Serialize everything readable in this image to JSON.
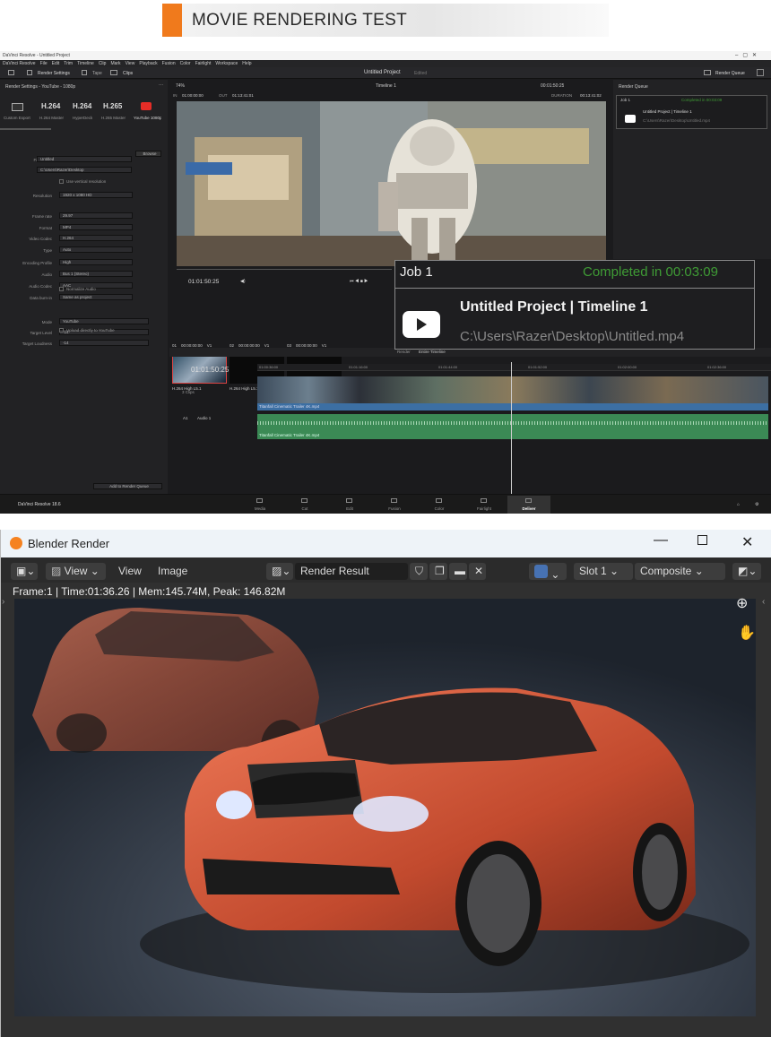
{
  "banner": {
    "title": "MOVIE RENDERING TEST",
    "accent": "#f07a1c"
  },
  "resolve": {
    "window_title": "DaVinci Resolve - Untitled Project",
    "menu": [
      "DaVinci Resolve",
      "File",
      "Edit",
      "Trim",
      "Timeline",
      "Clip",
      "Mark",
      "View",
      "Playback",
      "Fusion",
      "Color",
      "Fairlight",
      "Workspace",
      "Help"
    ],
    "toolbar": {
      "render_settings": "Render Settings",
      "tape": "Tape",
      "clips": "Clips",
      "project_title": "Untitled Project",
      "edited": "Edited",
      "render_queue": "Render Queue"
    },
    "render_settings_title": "Render Settings - YouTube - 1080p",
    "presets": [
      {
        "big": "",
        "label": "Custom Export"
      },
      {
        "big": "H.264",
        "label": "H.264 Master"
      },
      {
        "big": "H.264",
        "label": "HyperDeck"
      },
      {
        "big": "H.265",
        "label": "H.265 Master"
      },
      {
        "big": "",
        "label": "YouTube 1080p"
      }
    ],
    "settings": [
      {
        "label": "File Name",
        "value": "Untitled"
      },
      {
        "label": "Location",
        "value": "C:\\Users\\Razer\\Desktop"
      },
      {
        "label": "Resolution",
        "value": "1920 x 1080 HD"
      },
      {
        "label": "Frame rate",
        "value": "29.97"
      },
      {
        "label": "Format",
        "value": "MP4"
      },
      {
        "label": "Video Codec",
        "value": "H.264"
      },
      {
        "label": "Type",
        "value": "Auto"
      },
      {
        "label": "Encoding Profile",
        "value": "High"
      },
      {
        "label": "Audio",
        "value": "Bus 1 (Stereo)"
      },
      {
        "label": "Audio Codec",
        "value": "AAC"
      },
      {
        "label": "Data burn-in",
        "value": "Same as project"
      },
      {
        "label": "Mode",
        "value": "YouTube"
      },
      {
        "label": "Target Level",
        "value": "-14"
      },
      {
        "label": "Target Loudness",
        "value": "-14"
      }
    ],
    "browse": "Browse",
    "use_vertical": "Use vertical resolution",
    "normalize_audio": "Normalize Audio",
    "upload_youtube": "Upload directly to YouTube",
    "add_to_queue": "Add to Render Queue",
    "zoom": "74%",
    "timeline_name": "Timeline 1",
    "timecode_top": "00:01:50:25",
    "in_label": "IN",
    "in_tc": "01:00:00:00",
    "out_label": "OUT",
    "out_tc": "01:13:41:01",
    "duration_label": "DURATION",
    "duration_tc": "00:13:41:02",
    "playhead_tc": "01:01:50:25",
    "clips": [
      {
        "num": "01",
        "tc": "00:00:00:00",
        "track": "V1",
        "name": "H.264 High L5.1"
      },
      {
        "num": "02",
        "tc": "00:00:00:00",
        "track": "V1",
        "name": "H.264 High L5.1"
      },
      {
        "num": "03",
        "tc": "00:00:00:00",
        "track": "V1",
        "name": "MPEG4 Video"
      }
    ],
    "render_label": "Render",
    "render_range": "Entire Timeline",
    "timeline_tc": "01:01:50:25",
    "ruler": [
      "01:00:36:00",
      "01:01:16:00",
      "01:01:44:00",
      "01:01:52:00",
      "01:02:00:00",
      "01:02:36:00"
    ],
    "video_track": {
      "count": "3 Clips",
      "clip": "Titanfall Cinematic Trailer 4K.mp4"
    },
    "audio_track": {
      "id": "A1",
      "name": "Audio 1",
      "clip": "Titanfall Cinematic Trailer 4K.mp4"
    },
    "render_queue_title": "Render Queue",
    "job_small": {
      "title": "Job 1",
      "status": "Completed in 00:03:09",
      "project": "Untitled Project | Timeline 1",
      "path": "C:\\Users\\Razer\\Desktop\\Untitled.mp4"
    },
    "version": "DaVinci Resolve 18.6",
    "pages": [
      "Media",
      "Cut",
      "Edit",
      "Fusion",
      "Color",
      "Fairlight",
      "Deliver"
    ],
    "active_page": "Deliver"
  },
  "popup": {
    "title": "Job 1",
    "status": "Completed in 00:03:09",
    "project": "Untitled Project | Timeline 1",
    "path": "C:\\Users\\Razer\\Desktop\\Untitled.mp4",
    "status_color": "#3f9c35"
  },
  "blender": {
    "title": "Blender Render",
    "view_menu": "View",
    "view2": "View",
    "image": "Image",
    "image_name": "Render Result",
    "slot": "Slot 1",
    "pass": "Composite",
    "stats": "Frame:1 | Time:01:36.26 | Mem:145.74M, Peak: 146.82M"
  }
}
